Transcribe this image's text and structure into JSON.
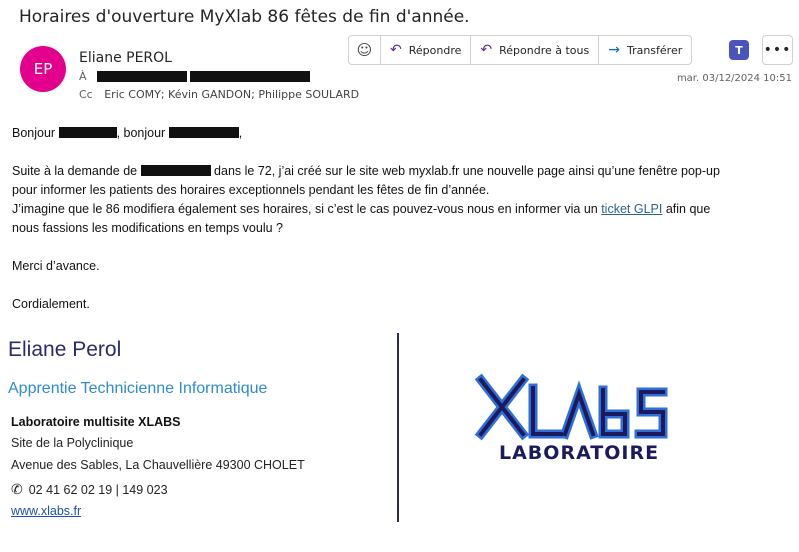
{
  "email": {
    "subject": "Horaires d'ouverture MyXlab 86 fêtes de fin d'année.",
    "avatar_initials": "EP",
    "sender": "Eliane PEROL",
    "to_label": "À",
    "cc_label": "Cc",
    "cc": "Eric COMY; Kévin GANDON; Philippe SOULARD",
    "date": "mar. 03/12/2024 10:51"
  },
  "toolbar": {
    "emoji_icon": "smiley-icon",
    "reply_label": "Répondre",
    "reply_all_label": "Répondre à tous",
    "forward_label": "Transférer",
    "teams_icon": "teams-icon",
    "more_icon": "more-icon",
    "more_label": "•••",
    "teams_label": "T"
  },
  "body": {
    "greeting_a": "Bonjour ",
    "greeting_b": ", bonjour ",
    "greeting_c": ",",
    "p1_a": "Suite à la demande de ",
    "p1_b": " dans le 72, j’ai créé sur le site web myxlab.fr une nouvelle page ainsi qu’une fenêtre pop-up",
    "p1_c": "pour informer les patients des horaires exceptionnels pendant les fêtes de fin d’année.",
    "p2_a": "J’imagine que le 86 modifiera également ses horaires, si c’est le cas pouvez-vous nous en informer via un ",
    "p2_link": "ticket GLPI",
    "p2_b": " afin que",
    "p2_c": "nous fassions les modifications en temps voulu ?",
    "thanks": "Merci d’avance.",
    "closing": "Cordialement."
  },
  "signature": {
    "name": "Eliane Perol",
    "title": "Apprentie Technicienne Informatique",
    "lab": "Laboratoire multisite XLABS",
    "site": "Site de la Polyclinique",
    "address": "Avenue des Sables, La Chauvellière 49300 CHOLET",
    "phone": "02 41 62 02 19 | 149 023",
    "website": "www.xlabs.fr",
    "logo_text": "XLabS",
    "logo_subtext": "LABORATOIRE"
  },
  "colors": {
    "avatar": "#e3008c",
    "logo_fill": "#1c1a5e",
    "logo_outline": "#2f6fd6",
    "title_blue": "#2d8ccc"
  }
}
